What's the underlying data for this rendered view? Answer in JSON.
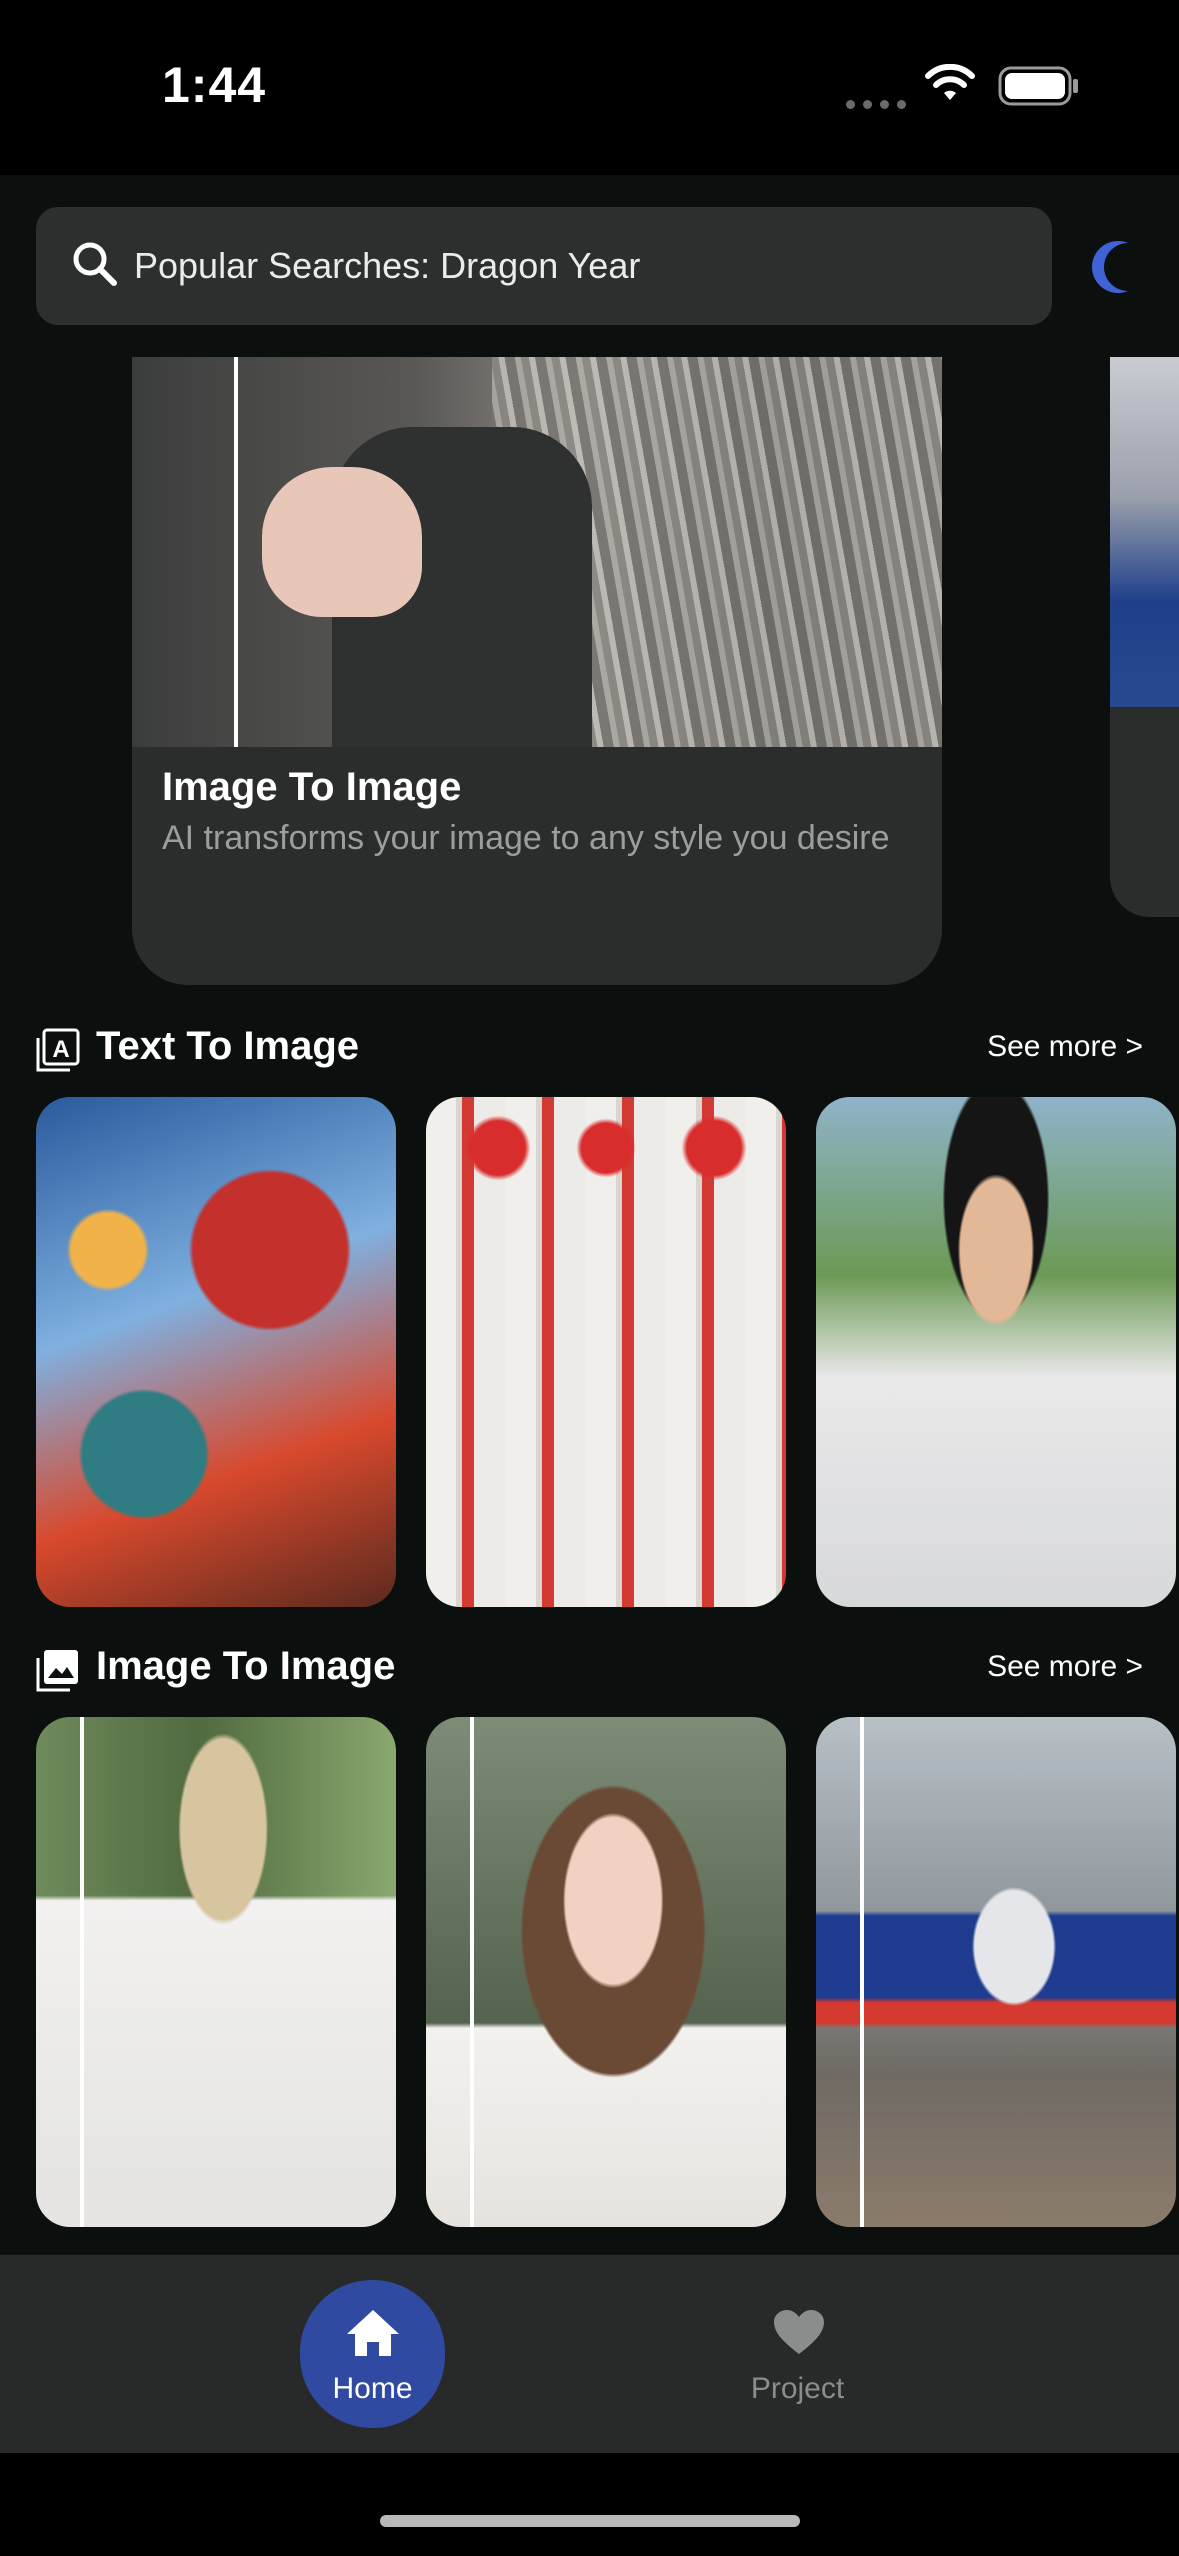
{
  "status_bar": {
    "time": "1:44"
  },
  "search": {
    "placeholder": "Popular Searches: Dragon Year"
  },
  "featured": {
    "title": "Image To Image",
    "description": "AI transforms your image to any style you desire"
  },
  "sections": [
    {
      "title": "Text To Image",
      "see_more": "See more >",
      "icon": "text-image-icon"
    },
    {
      "title": "Image To Image",
      "see_more": "See more >",
      "icon": "gallery-icon"
    }
  ],
  "tab_bar": {
    "home": "Home",
    "project": "Project"
  },
  "colors": {
    "accent": "#2f4aa0",
    "moon": "#3f62d6",
    "background": "#0b100f",
    "card": "#2a2d2c"
  }
}
